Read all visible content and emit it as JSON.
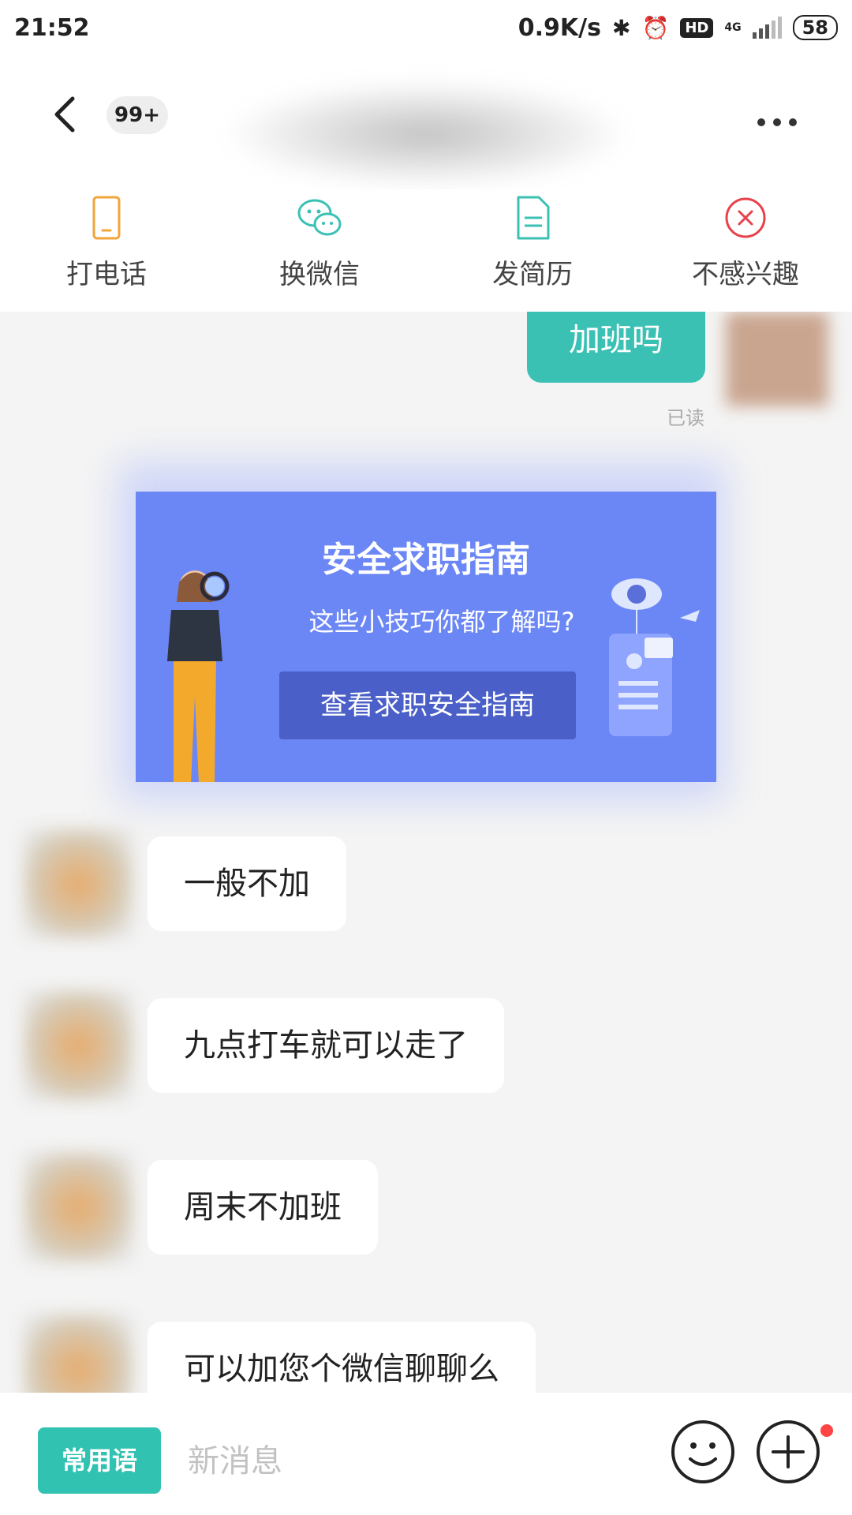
{
  "status_bar": {
    "time": "21:52",
    "speed": "0.9K/s",
    "hd": "HD",
    "network": "4G",
    "battery": "58"
  },
  "header": {
    "unread_count": "99+"
  },
  "actions": [
    {
      "label": "打电话",
      "icon": "phone-icon",
      "color": "#f0a63a"
    },
    {
      "label": "换微信",
      "icon": "wechat-icon",
      "color": "#3bc1b4"
    },
    {
      "label": "发简历",
      "icon": "resume-icon",
      "color": "#3bc1b4"
    },
    {
      "label": "不感兴趣",
      "icon": "not-interested-icon",
      "color": "#e8424a"
    }
  ],
  "chat": {
    "outgoing": {
      "text": "加班吗",
      "status": "已读"
    },
    "banner": {
      "title": "安全求职指南",
      "subtitle": "这些小技巧你都了解吗?",
      "button": "查看求职安全指南"
    },
    "incoming": [
      {
        "text": "一般不加"
      },
      {
        "text": "九点打车就可以走了"
      },
      {
        "text": "周末不加班"
      },
      {
        "text": "可以加您个微信聊聊么"
      }
    ]
  },
  "composer": {
    "quick_phrases": "常用语",
    "placeholder": "新消息"
  },
  "colors": {
    "accent": "#3bc1b4",
    "banner_bg": "#6b86f5"
  }
}
